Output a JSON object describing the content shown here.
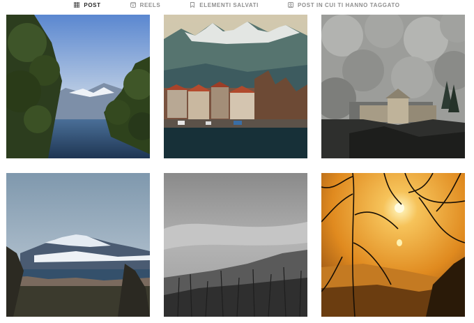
{
  "tabs": [
    {
      "label": "POST",
      "icon": "grid-icon",
      "active": true
    },
    {
      "label": "REELS",
      "icon": "reels-icon",
      "active": false
    },
    {
      "label": "ELEMENTI SALVATI",
      "icon": "bookmark-icon",
      "active": false
    },
    {
      "label": "POST IN CUI TI HANNO TAGGATO",
      "icon": "tagged-icon",
      "active": false
    }
  ],
  "posts": [
    {
      "subject": "olive branches framing a lake with snowy mountains",
      "colors": {
        "sky": "#6a96d6",
        "water": "#2f4a6b",
        "leaves": "#2b3a1a"
      }
    },
    {
      "subject": "lakeside village with red roofs below rocky peaks",
      "colors": {
        "sky": "#d8d0b8",
        "mountain": "#4f6e6a",
        "water": "#18323a",
        "roofs": "#a04a2c"
      }
    },
    {
      "subject": "snowy forest with a church on a rocky hill",
      "colors": {
        "sky": "#a9aaa7",
        "trees": "#5f615d",
        "church": "#b9ab90"
      }
    },
    {
      "subject": "snow capped mountain over a lake under cloudy sky",
      "colors": {
        "sky": "#9fb2c2",
        "mountain": "#45566c",
        "snow": "#dfe6ee",
        "ground": "#3a3a2f"
      }
    },
    {
      "subject": "black and white misty forest hillside",
      "colors": {
        "sky": "#9a9a9a",
        "hill": "#3c3c3c"
      }
    },
    {
      "subject": "sunset over a lake through bare branches",
      "colors": {
        "sky": "#e8a13a",
        "glow": "#fff2b0",
        "water": "#c07a20",
        "branches": "#1a1208"
      }
    }
  ]
}
